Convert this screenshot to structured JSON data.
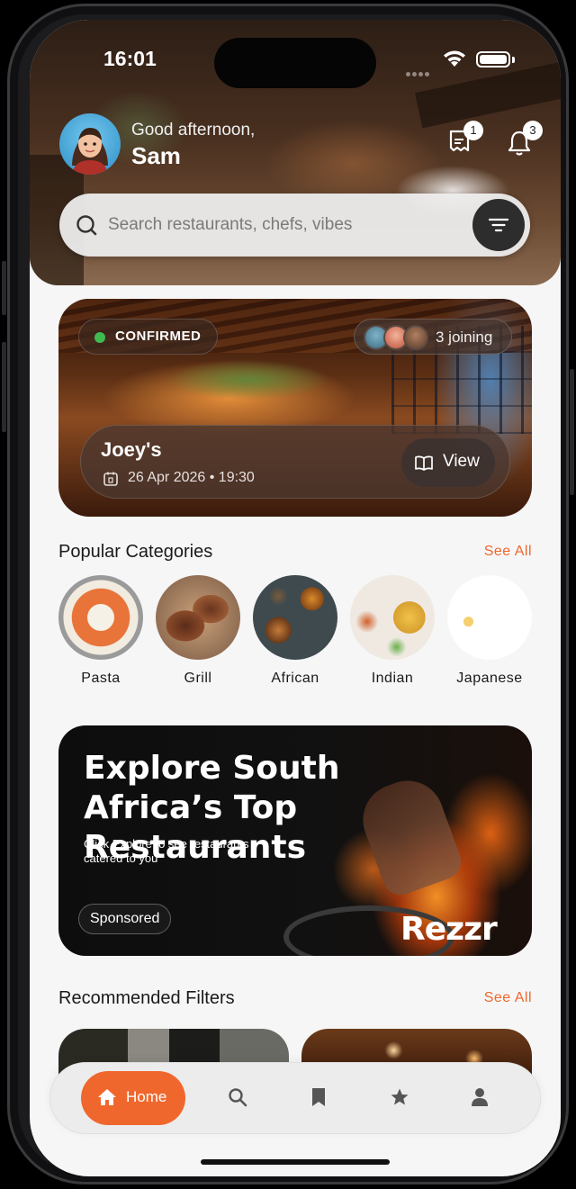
{
  "status_bar": {
    "time": "16:01"
  },
  "header": {
    "greeting": "Good afternoon,",
    "user_name": "Sam",
    "messages_badge": "1",
    "notifications_badge": "3"
  },
  "search": {
    "placeholder": "Search restaurants, chefs, vibes"
  },
  "booking": {
    "status": "CONFIRMED",
    "joining": "3 joining",
    "restaurant": "Joey's",
    "date_time": "26 Apr 2026 • 19:30",
    "view_label": "View"
  },
  "categories": {
    "title": "Popular Categories",
    "see_all": "See All",
    "items": [
      {
        "label": "Pasta"
      },
      {
        "label": "Grill"
      },
      {
        "label": "African"
      },
      {
        "label": "Indian"
      },
      {
        "label": "Japanese"
      }
    ]
  },
  "promo": {
    "title": "Explore South Africa’s Top Restaurants",
    "subtitle": "Click Explore to see restaurants catered to you",
    "sponsored": "Sponsored",
    "brand": "Rezzr"
  },
  "recommended": {
    "title": "Recommended Filters",
    "see_all": "See All"
  },
  "bottom_nav": {
    "home_label": "Home",
    "icons": [
      "home-icon",
      "search-icon",
      "bookmark-icon",
      "star-icon",
      "profile-icon"
    ]
  },
  "colors": {
    "accent": "#f0672d",
    "confirmed": "#3fb950"
  }
}
